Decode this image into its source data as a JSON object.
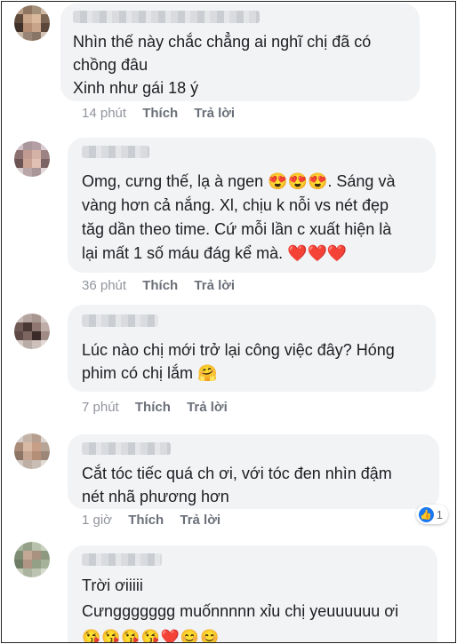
{
  "comments": [
    {
      "lines": [
        "Nhìn thế này chắc chẳng ai nghĩ chị đã có",
        "chồng đâu",
        "Xinh như gái 18 ý"
      ],
      "time": "14 phút",
      "like": "Thích",
      "reply": "Trả lời"
    },
    {
      "lines": [
        "Omg, cưng thế, lạ à ngen 😍😍😍. Sáng và",
        "vàng hơn cả nắng. Xl, chịu k nỗi vs nét đẹp",
        "tăg dần theo time. Cứ mỗi lần c xuất hiện là",
        "lại mất 1 số máu đág kể mà. ❤️❤️❤️"
      ],
      "time": "36 phút",
      "like": "Thích",
      "reply": "Trả lời"
    },
    {
      "lines": [
        "Lúc nào chị mới trở lại công việc đây? Hóng",
        "phim có chị lắm 🤗"
      ],
      "time": "7 phút",
      "like": "Thích",
      "reply": "Trả lời"
    },
    {
      "lines": [
        "Cắt tóc tiếc quá ch ơi,  với tóc đen nhìn đậm",
        "nét nhã phương hơn"
      ],
      "time": "1 giờ",
      "like": "Thích",
      "reply": "Trả lời",
      "reaction_count": "1",
      "reaction_icon": "like-icon"
    },
    {
      "lines": [
        "Trời ơiiiii",
        "Cưnggggggg muốnnnnn xỉu chị yeuuuuuu ơi",
        "😘😘😘😘❤️😊😊"
      ]
    }
  ]
}
